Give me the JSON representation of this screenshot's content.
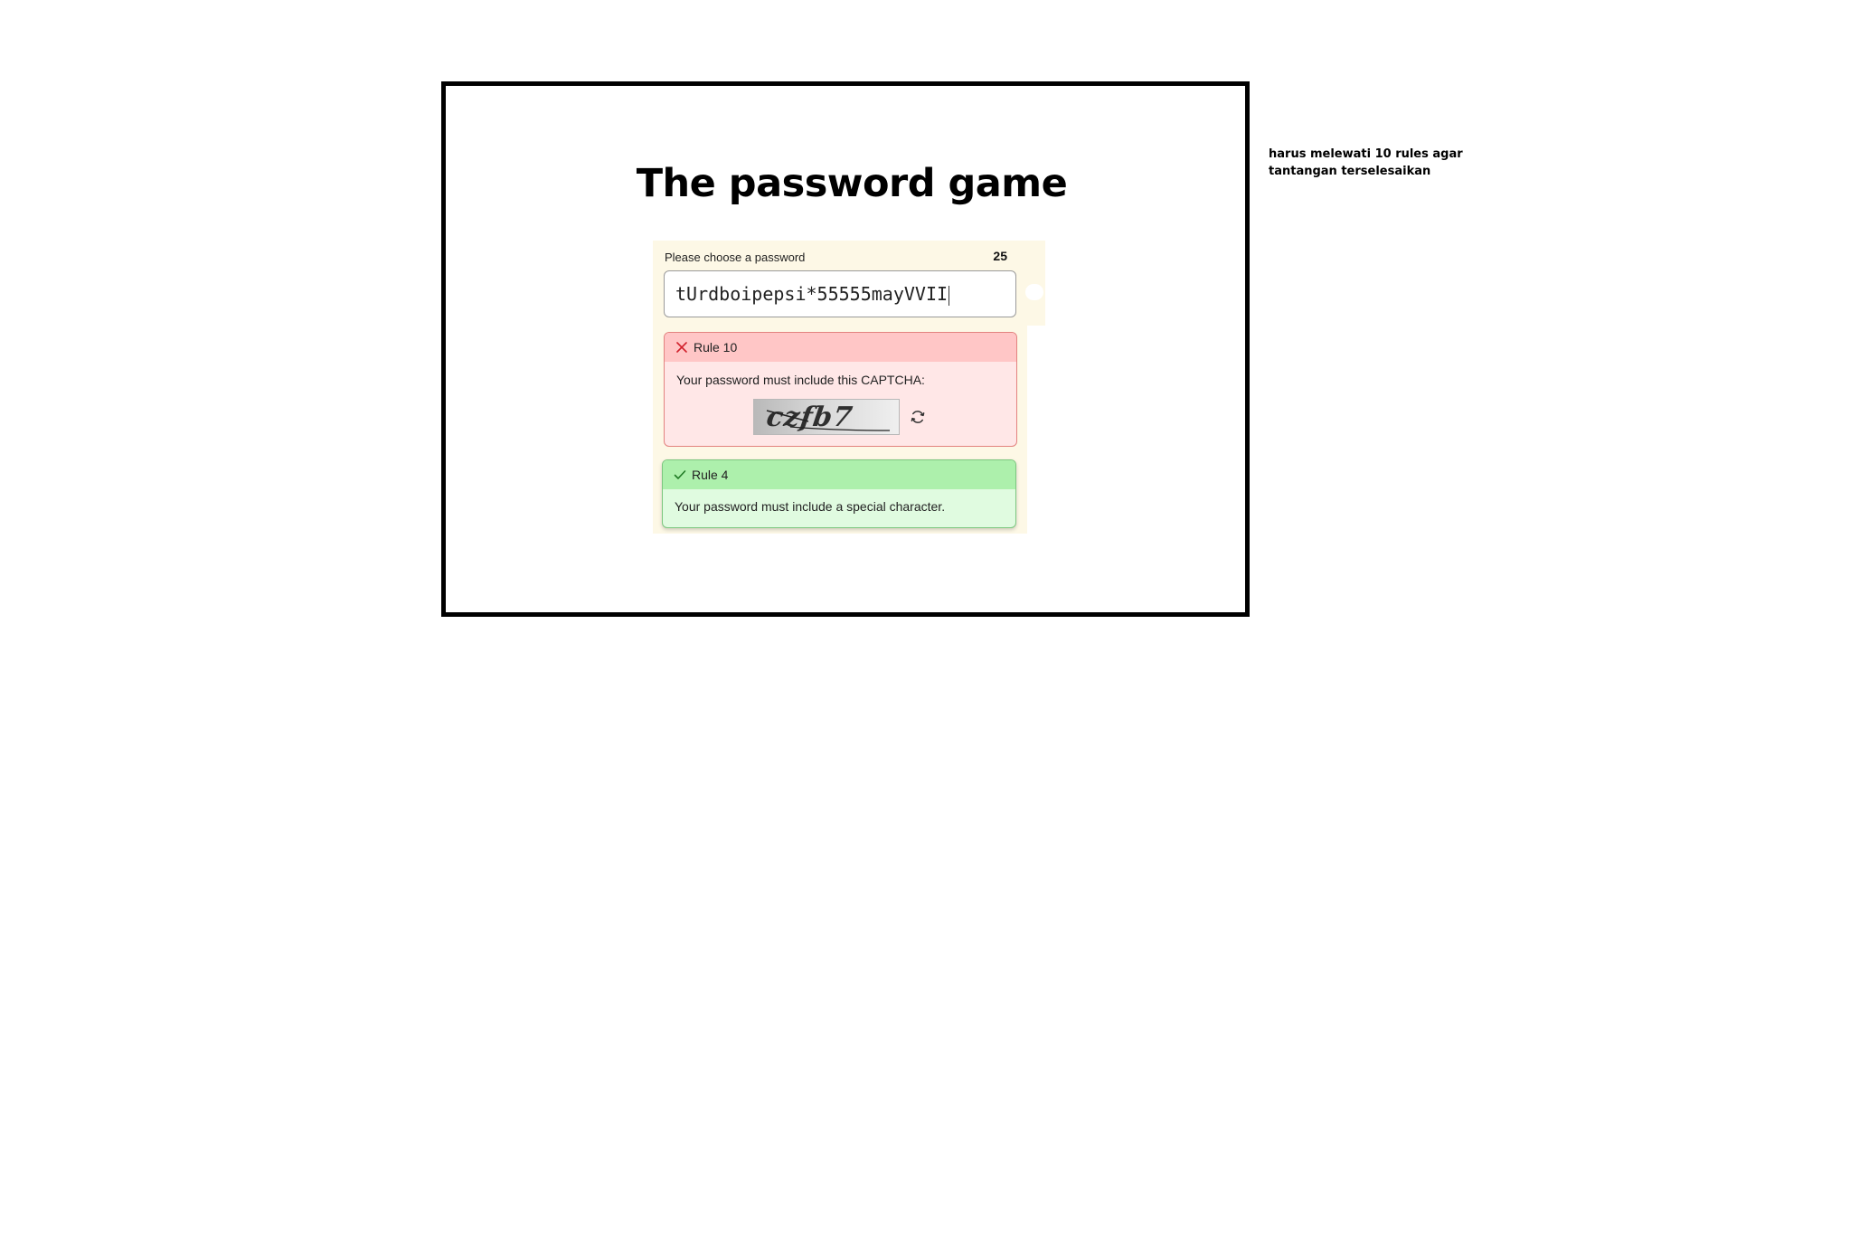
{
  "page": {
    "title": "The password game"
  },
  "password": {
    "label": "Please choose a password",
    "char_count": "25",
    "value": "tUrdboipepsi*55555mayVVII"
  },
  "rules": [
    {
      "number_label": "Rule 10",
      "status": "fail",
      "status_icon": "x-icon",
      "text": "Your password must include this CAPTCHA:",
      "captcha": {
        "text": "czfb7",
        "refresh_icon": "refresh-icon"
      }
    },
    {
      "number_label": "Rule 4",
      "status": "pass",
      "status_icon": "check-icon",
      "text": "Your password must include a special character."
    }
  ],
  "note": {
    "text": "harus melewati 10 rules agar tantangan terselesaikan"
  },
  "colors": {
    "fail_header": "#ffc6c6",
    "fail_body": "#ffe7e7",
    "pass_header": "#adf0ac",
    "pass_body": "#e0fbe0",
    "panel_bg": "#fdf8e6"
  }
}
